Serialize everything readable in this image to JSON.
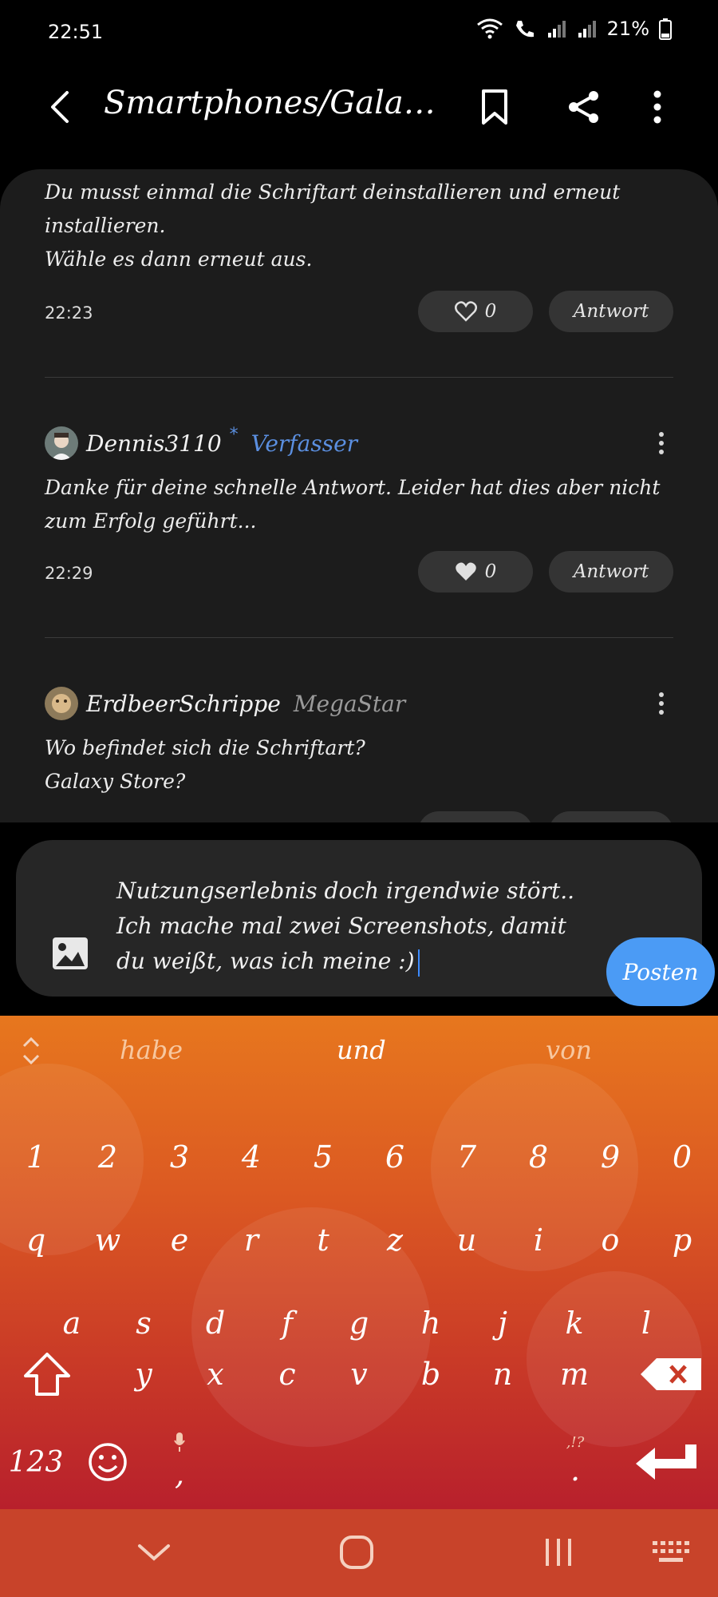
{
  "status_bar": {
    "time": "22:51",
    "battery": "21%"
  },
  "header": {
    "title": "Smartphones/Galaxy…"
  },
  "comments": [
    {
      "text": "Du musst einmal die Schriftart deinstallieren und erneut installieren.\nWähle es dann erneut aus.",
      "time": "22:23",
      "likes": "0",
      "reply_label": "Antwort"
    },
    {
      "author": "Dennis3110",
      "author_mark": "*",
      "badge": "Verfasser",
      "badge_color": "#5b8fe0",
      "text": "Danke für deine schnelle Antwort. Leider hat dies aber nicht zum Erfolg geführt...",
      "time": "22:29",
      "likes": "0",
      "reply_label": "Antwort"
    },
    {
      "author": "ErdbeerSchrippe",
      "badge": "MegaStar",
      "badge_color": "#9a9a9a",
      "text": "Wo befindet sich die Schriftart?\nGalaxy Store?"
    }
  ],
  "composer": {
    "text": "Nutzungserlebnis doch irgendwie stört..\nIch mache mal zwei Screenshots, damit du weißt, was ich meine :)",
    "post_label": "Posten",
    "post_color": "#4b9bf5"
  },
  "keyboard": {
    "suggestions": [
      "habe",
      "und",
      "von"
    ],
    "number_row": [
      "1",
      "2",
      "3",
      "4",
      "5",
      "6",
      "7",
      "8",
      "9",
      "0"
    ],
    "row1": [
      "q",
      "w",
      "e",
      "r",
      "t",
      "z",
      "u",
      "i",
      "o",
      "p"
    ],
    "row2": [
      "a",
      "s",
      "d",
      "f",
      "g",
      "h",
      "j",
      "k",
      "l"
    ],
    "row3": [
      "y",
      "x",
      "c",
      "v",
      "b",
      "n",
      "m"
    ],
    "symbols_label": "123",
    "comma_label": ",",
    "period_label": ".",
    "punct_hint": ",!?"
  },
  "icons": {
    "back": "chevron-left-icon",
    "bookmark": "bookmark-icon",
    "share": "share-icon",
    "more": "more-vertical-icon",
    "like": "heart-icon",
    "image": "image-icon"
  }
}
